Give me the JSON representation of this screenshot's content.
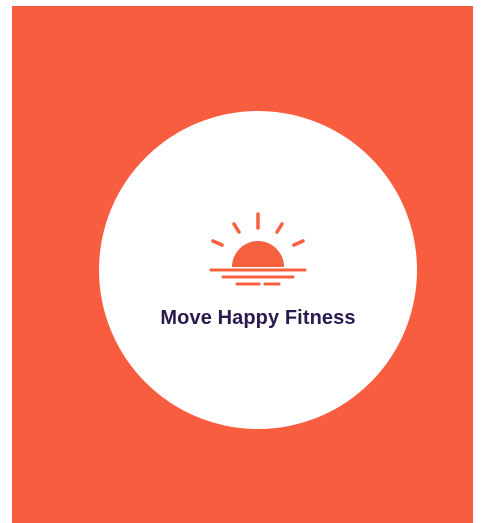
{
  "brand": {
    "name": "Move Happy Fitness",
    "logo_icon": "sunrise-icon"
  },
  "colors": {
    "background": "#f95d3f",
    "circle": "#ffffff",
    "accent": "#f5603e",
    "text": "#2a1b4f"
  }
}
